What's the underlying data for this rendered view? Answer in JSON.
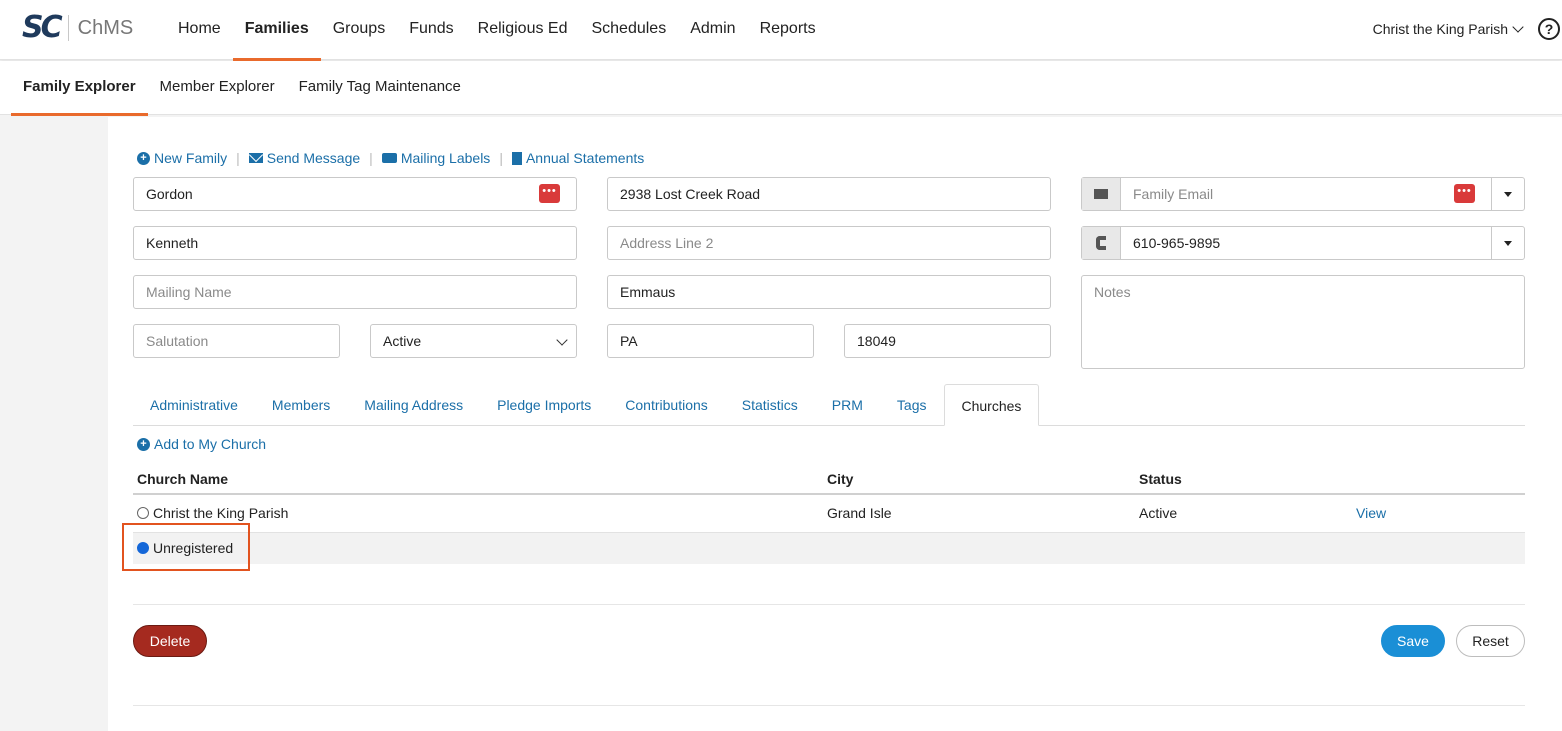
{
  "app": {
    "logo_mark": "SC",
    "logo_text": "ChMS"
  },
  "nav": {
    "items": [
      {
        "label": "Home"
      },
      {
        "label": "Families",
        "active": true
      },
      {
        "label": "Groups"
      },
      {
        "label": "Funds"
      },
      {
        "label": "Religious Ed"
      },
      {
        "label": "Schedules"
      },
      {
        "label": "Admin"
      },
      {
        "label": "Reports"
      }
    ],
    "parish": "Christ the King Parish",
    "help_symbol": "?"
  },
  "subnav": {
    "items": [
      {
        "label": "Family Explorer",
        "active": true
      },
      {
        "label": "Member Explorer"
      },
      {
        "label": "Family Tag Maintenance"
      }
    ]
  },
  "actions": {
    "new_family": "New Family",
    "send_message": "Send Message",
    "mailing_labels": "Mailing Labels",
    "annual_statements": "Annual Statements"
  },
  "form": {
    "last_name": "Gordon",
    "first_name": "Kenneth",
    "mailing_name_placeholder": "Mailing Name",
    "salutation_placeholder": "Salutation",
    "status": "Active",
    "address1": "2938 Lost Creek Road",
    "address2_placeholder": "Address Line 2",
    "city": "Emmaus",
    "state": "PA",
    "zip": "18049",
    "email_placeholder": "Family Email",
    "phone": "610-965-9895",
    "notes_placeholder": "Notes"
  },
  "tabs": [
    {
      "label": "Administrative"
    },
    {
      "label": "Members"
    },
    {
      "label": "Mailing Address"
    },
    {
      "label": "Pledge Imports"
    },
    {
      "label": "Contributions"
    },
    {
      "label": "Statistics"
    },
    {
      "label": "PRM"
    },
    {
      "label": "Tags"
    },
    {
      "label": "Churches",
      "active": true
    }
  ],
  "churches": {
    "add_label": "Add to My Church",
    "columns": {
      "name": "Church Name",
      "city": "City",
      "status": "Status"
    },
    "rows": [
      {
        "name": "Christ the King Parish",
        "city": "Grand Isle",
        "status": "Active",
        "action": "View",
        "selected": false
      },
      {
        "name": "Unregistered",
        "city": "",
        "status": "",
        "action": "",
        "selected": true
      }
    ]
  },
  "buttons": {
    "delete": "Delete",
    "save": "Save",
    "reset": "Reset"
  },
  "colors": {
    "accent": "#e96a2c",
    "link": "#1b6fa8",
    "save": "#1a8fd6",
    "delete": "#a52a1f",
    "highlight": "#e2531f"
  }
}
